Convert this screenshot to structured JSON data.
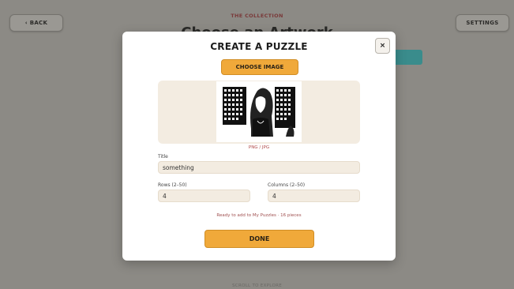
{
  "background": {
    "back_label": "‹ BACK",
    "collection_label": "THE COLLECTION",
    "heading": "Choose an Artwork",
    "settings_label": "SETTINGS",
    "scroll_hint": "SCROLL TO EXPLORE"
  },
  "modal": {
    "title": "CREATE A PUZZLE",
    "close_label": "×",
    "choose_image_label": "CHOOSE IMAGE",
    "file_types": "PNG / JPG",
    "title_label": "Title",
    "title_value": "something",
    "rows_label": "Rows (2–50)",
    "rows_value": "4",
    "columns_label": "Columns (2–50)",
    "columns_value": "4",
    "status": "Ready to add to My Puzzles · 16 pieces",
    "done_label": "DONE"
  },
  "colors": {
    "accent": "#f0a93a",
    "field_bg": "#f3ece1",
    "overlay": "#8c8a85"
  }
}
